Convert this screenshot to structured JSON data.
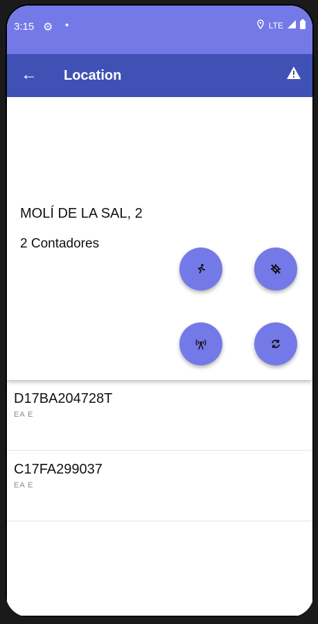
{
  "status": {
    "time": "3:15",
    "network": "LTE"
  },
  "appbar": {
    "title": "Location"
  },
  "location": {
    "address": "MOLÍ DE LA SAL, 2",
    "count": "2 Contadores"
  },
  "meters": [
    {
      "code": "D17BA204728T",
      "sub": "EA  E"
    },
    {
      "code": "C17FA299037",
      "sub": "EA  E"
    }
  ],
  "icons": {
    "fab_1": "running-icon",
    "fab_2": "no-location-icon",
    "fab_3": "antenna-icon",
    "fab_4": "sync-icon"
  },
  "colors": {
    "status_bar": "#7479e8",
    "app_bar": "#3f51b5",
    "fab": "#7479e8"
  }
}
